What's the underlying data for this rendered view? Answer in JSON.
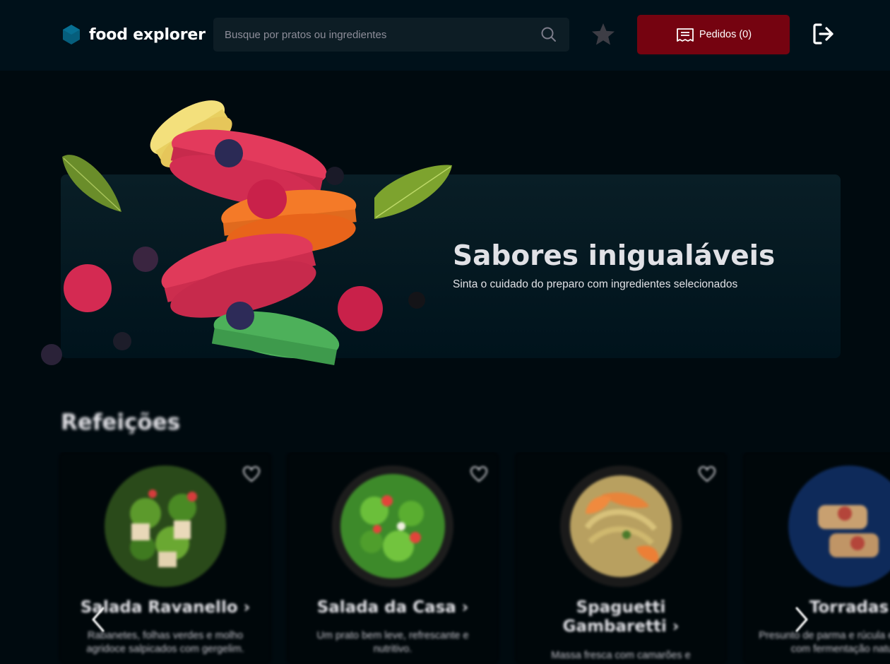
{
  "app": {
    "name": "food explorer"
  },
  "search": {
    "placeholder": "Busque por pratos ou ingredientes"
  },
  "header": {
    "orders_label": "Pedidos (0)"
  },
  "banner": {
    "title": "Sabores inigualáveis",
    "subtitle": "Sinta o cuidado do preparo com ingredientes selecionados"
  },
  "section": {
    "title": "Refeições"
  },
  "dishes": [
    {
      "name": "Salada Ravanello ›",
      "description": "Rabanetes, folhas verdes e molho agridoce salpicados com gergelim."
    },
    {
      "name": "Salada da Casa ›",
      "description": "Um prato bem leve, refrescante e nutritivo."
    },
    {
      "name": "Spaguetti Gambaretti ›",
      "description": "Massa fresca com camarões e"
    },
    {
      "name": "Torradas",
      "description": "Presunto de parma e rúcula em um pão com fermentação natural."
    }
  ],
  "colors": {
    "header_bg": "#00111a",
    "page_bg": "#000a0f",
    "accent": "#750310",
    "logo": "#065e7c"
  },
  "icons": {
    "logo": "hexagon-logo-icon",
    "search": "search-icon",
    "favorites": "star-icon",
    "orders": "receipt-icon",
    "logout": "sign-out-icon",
    "favorite_dish": "heart-icon",
    "carousel_prev": "chevron-left-icon",
    "carousel_next": "chevron-right-icon"
  }
}
